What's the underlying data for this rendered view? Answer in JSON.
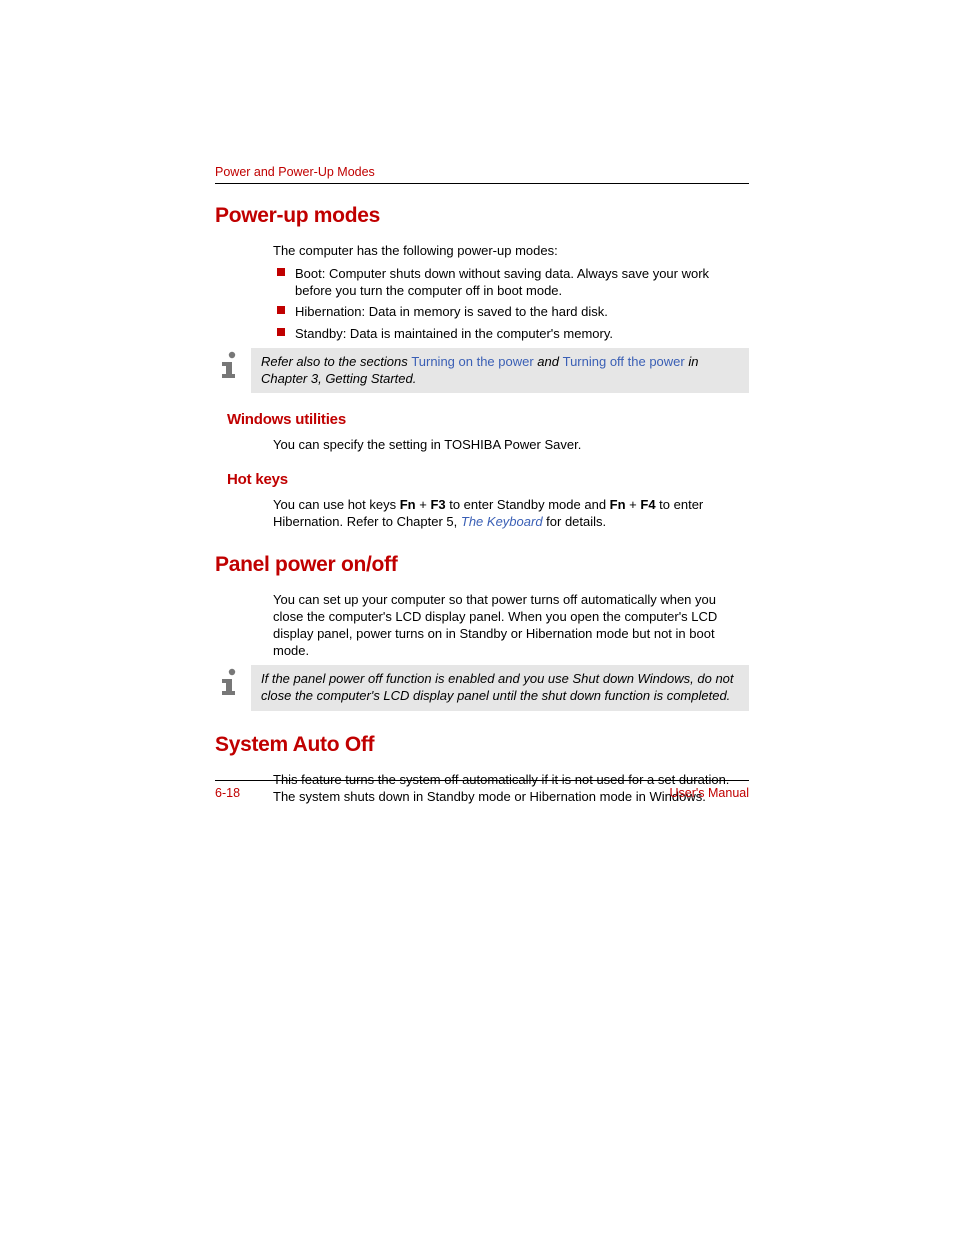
{
  "header": {
    "running_title": "Power and Power-Up Modes"
  },
  "section1": {
    "title": "Power-up modes",
    "intro": "The computer has the following power-up modes:",
    "bullets": [
      "Boot: Computer shuts down without saving data. Always save your work before you turn the computer off in boot mode.",
      "Hibernation: Data in memory is saved to the hard disk.",
      "Standby: Data is maintained in the computer's memory."
    ],
    "note": {
      "pre": "Refer also to the sections ",
      "link1": "Turning on the power",
      "mid": " and ",
      "link2": "Turning off the power",
      "post": " in Chapter 3, Getting Started."
    },
    "sub1": {
      "title": "Windows utilities",
      "body": "You can specify the setting in TOSHIBA Power Saver."
    },
    "sub2": {
      "title": "Hot keys",
      "p1a": "You can use hot keys ",
      "fn1": "Fn",
      "plus1": " + ",
      "f3": "F3",
      "p1b": " to enter Standby mode and ",
      "fn2": "Fn",
      "plus2": " + ",
      "f4": "F4",
      "p1c": " to enter Hibernation. Refer to Chapter 5, ",
      "link": "The Keyboard",
      "p1d": " for details."
    }
  },
  "section2": {
    "title": "Panel power on/off",
    "body": "You can set up your computer so that power turns off automatically when you close the computer's LCD display panel. When you open the computer's LCD display panel, power turns on in Standby or Hibernation mode but not in boot mode.",
    "note": "If the panel power off function is enabled and you use Shut down Windows, do not close the computer's LCD display panel until the shut down function is completed."
  },
  "section3": {
    "title": "System Auto Off",
    "body": "This feature turns the system off automatically if it is not used for a set duration. The system shuts down in Standby mode or Hibernation mode in Windows."
  },
  "footer": {
    "page": "6-18",
    "manual": "User's Manual"
  }
}
